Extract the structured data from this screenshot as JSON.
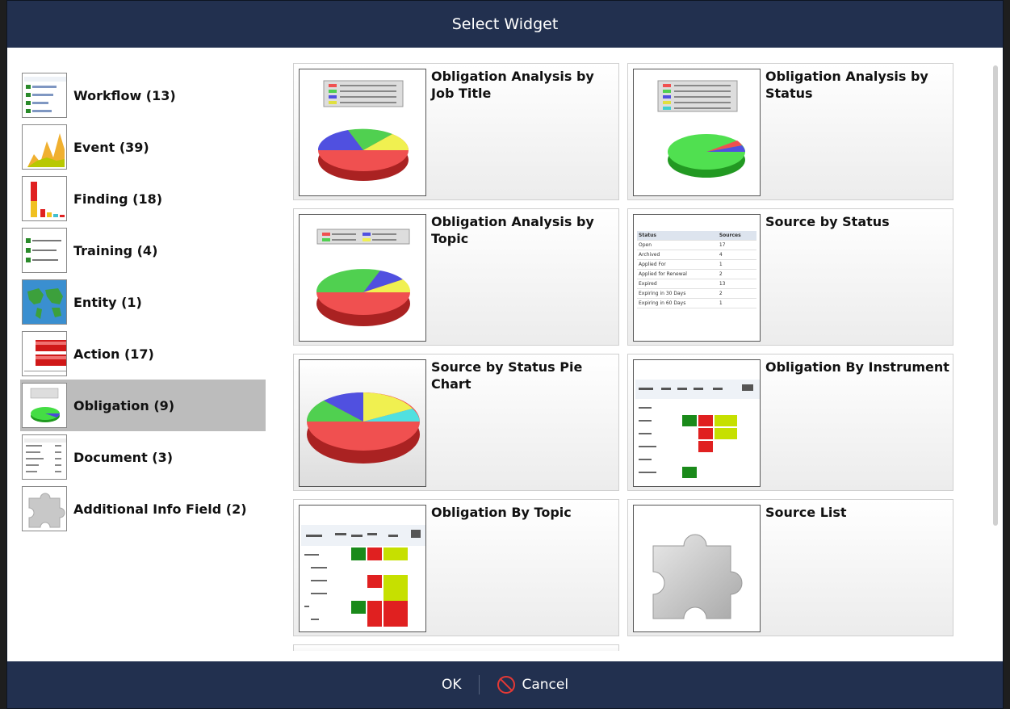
{
  "dialog": {
    "title": "Select Widget",
    "ok_label": "OK",
    "cancel_label": "Cancel"
  },
  "categories": [
    {
      "label": "Workflow (13)",
      "icon": "workflow-list-icon"
    },
    {
      "label": "Event (39)",
      "icon": "area-chart-icon"
    },
    {
      "label": "Finding (18)",
      "icon": "bar-chart-icon"
    },
    {
      "label": "Training (4)",
      "icon": "training-list-icon"
    },
    {
      "label": "Entity (1)",
      "icon": "world-map-icon"
    },
    {
      "label": "Action (17)",
      "icon": "horizontal-bar-icon"
    },
    {
      "label": "Obligation (9)",
      "icon": "pie-chart-icon",
      "selected": true
    },
    {
      "label": "Document (3)",
      "icon": "document-table-icon"
    },
    {
      "label": "Additional Info Field (2)",
      "icon": "puzzle-piece-icon"
    }
  ],
  "widgets": [
    {
      "title": "Obligation Analysis by Job Title"
    },
    {
      "title": "Obligation Analysis by Status"
    },
    {
      "title": "Obligation Analysis by Topic"
    },
    {
      "title": "Source by Status"
    },
    {
      "title": "Source by Status Pie Chart"
    },
    {
      "title": "Obligation By Instrument"
    },
    {
      "title": "Obligation By Topic"
    },
    {
      "title": "Source List"
    }
  ],
  "source_status_table": {
    "headers": [
      "Status",
      "Sources"
    ],
    "rows": [
      [
        "Open",
        "17"
      ],
      [
        "Archived",
        "4"
      ],
      [
        "Applied For",
        "1"
      ],
      [
        "Applied for Renewal",
        "2"
      ],
      [
        "Expired",
        "13"
      ],
      [
        "Expiring in 30 Days",
        "2"
      ],
      [
        "Expiring in 60 Days",
        "1"
      ]
    ]
  },
  "colors": {
    "accent": "#22304f",
    "selected": "#bcbcbc",
    "cancel": "#e53935"
  }
}
